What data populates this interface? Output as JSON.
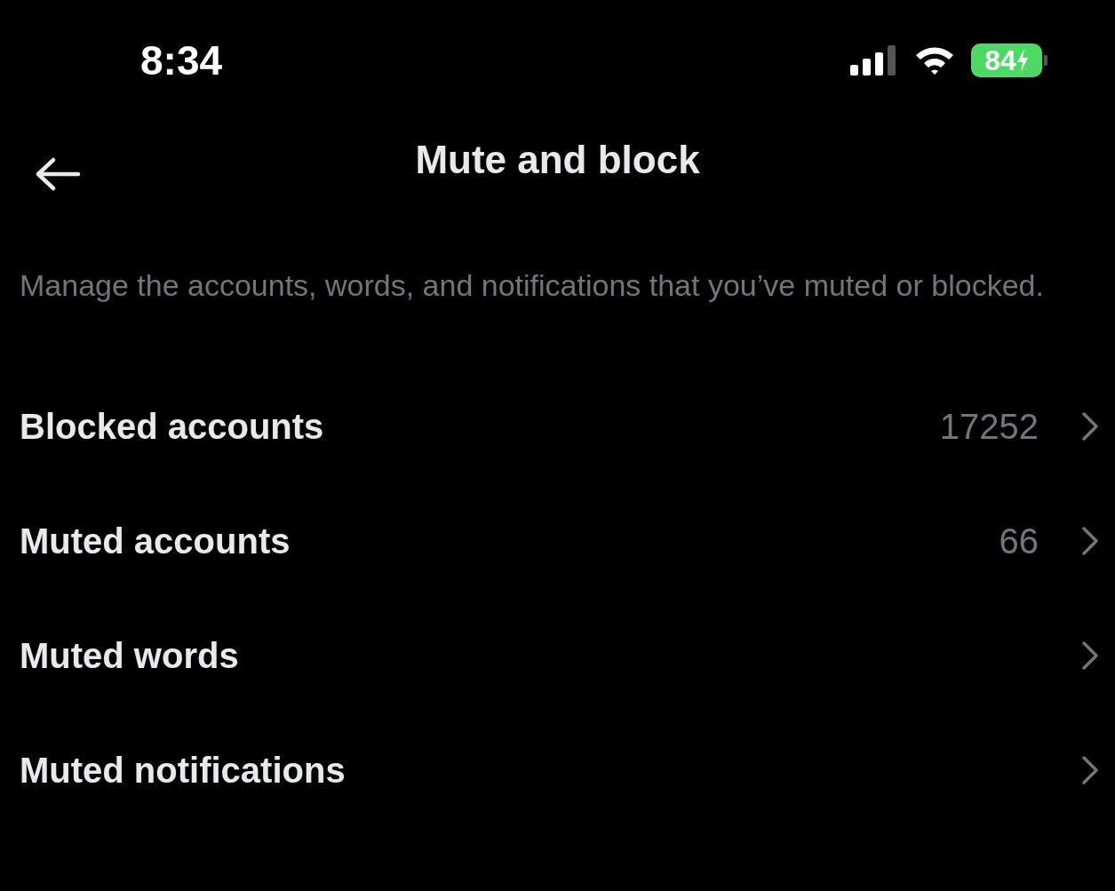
{
  "status_bar": {
    "time": "8:34",
    "battery": "84"
  },
  "header": {
    "title": "Mute and block"
  },
  "description": "Manage the accounts, words, and notifications that you’ve muted or blocked.",
  "items": [
    {
      "label": "Blocked accounts",
      "count": "17252"
    },
    {
      "label": "Muted accounts",
      "count": "66"
    },
    {
      "label": "Muted words"
    },
    {
      "label": "Muted notifications"
    }
  ]
}
